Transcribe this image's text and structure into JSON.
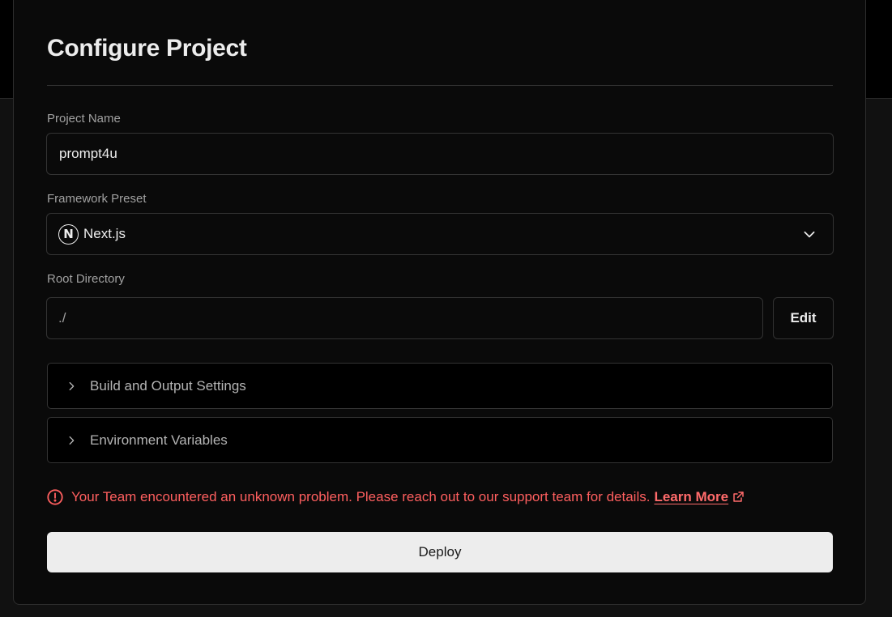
{
  "title": "Configure Project",
  "project_name": {
    "label": "Project Name",
    "value": "prompt4u"
  },
  "framework": {
    "label": "Framework Preset",
    "value": "Next.js",
    "logo_letter": "N",
    "icon": "chevron-down-icon"
  },
  "root_directory": {
    "label": "Root Directory",
    "value": "./",
    "edit_label": "Edit"
  },
  "sections": [
    {
      "label": "Build and Output Settings",
      "icon": "chevron-right-icon"
    },
    {
      "label": "Environment Variables",
      "icon": "chevron-right-icon"
    }
  ],
  "error": {
    "message": "Your Team encountered an unknown problem. Please reach out to our support team for details.",
    "link_label": "Learn More",
    "color": "#ff5f5f"
  },
  "deploy_label": "Deploy"
}
